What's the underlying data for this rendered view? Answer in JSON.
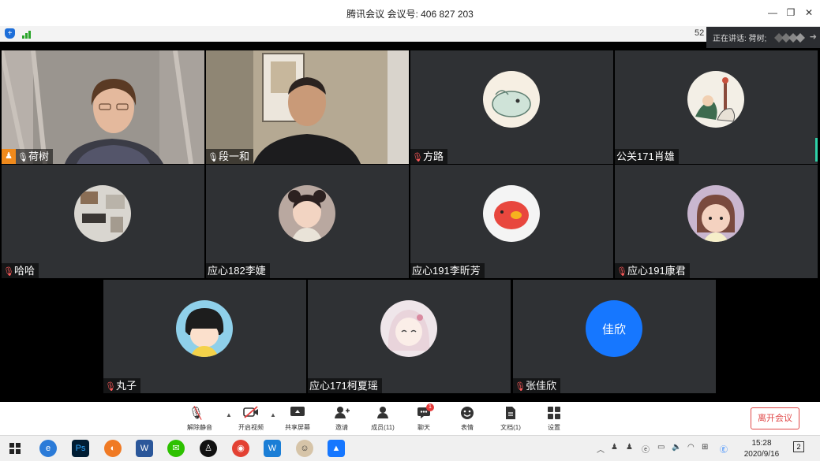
{
  "window": {
    "title": "腾讯会议 会议号: 406 827 203",
    "minimize": "—",
    "restore": "❐",
    "close": "✕"
  },
  "statusbar": {
    "percent": "52"
  },
  "speaking": {
    "text": "正在讲话: 荷树;"
  },
  "participants": [
    {
      "name": "荷树",
      "host": true,
      "mic": "on"
    },
    {
      "name": "段一和",
      "mic": "on"
    },
    {
      "name": "方路",
      "mic": "muted"
    },
    {
      "name": "公关171肖雄",
      "mic": "none"
    },
    {
      "name": "哈哈",
      "mic": "muted"
    },
    {
      "name": "应心182李婕",
      "mic": "none"
    },
    {
      "name": "应心191李昕芳",
      "mic": "none"
    },
    {
      "name": "应心191康君",
      "mic": "muted"
    },
    {
      "name": "丸子",
      "mic": "muted"
    },
    {
      "name": "应心171柯夏瑶",
      "mic": "none"
    },
    {
      "name": "张佳欣",
      "mic": "muted",
      "avatar_text": "佳欣"
    }
  ],
  "toolbar": {
    "unmute": "解除静音",
    "video": "开启视频",
    "share": "共享屏幕",
    "invite": "邀请",
    "members": "成员(11)",
    "chat": "聊天",
    "chat_badge": "1",
    "emoji": "表情",
    "docs": "文档(1)",
    "settings": "设置",
    "leave": "离开会议"
  },
  "taskbar": {
    "time": "15:28",
    "date": "2020/9/16",
    "notification_count": "2"
  },
  "colors": {
    "tile_bg": "#2f3134",
    "accent_blue": "#1677ff",
    "leave_red": "#e04848",
    "host_orange": "#f08a1c",
    "speaking_green": "#2fd1a8"
  }
}
